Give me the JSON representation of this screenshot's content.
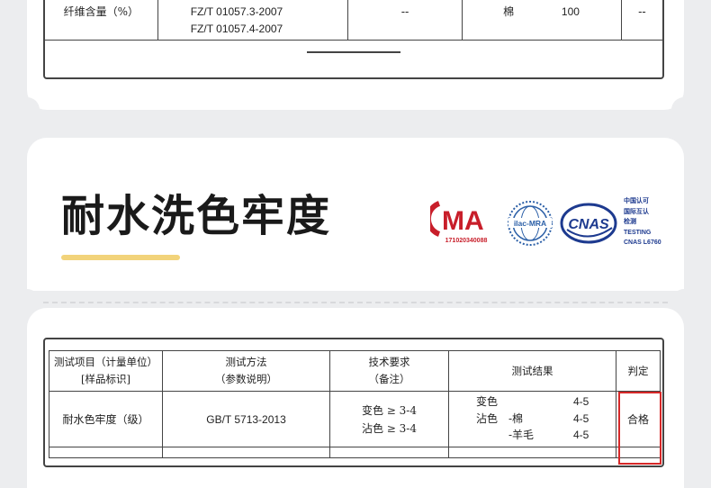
{
  "top_table": {
    "row": {
      "item": "纤维含量（%）",
      "methods": [
        "FZ/T 01057.3-2007",
        "FZ/T 01057.4-2007"
      ],
      "requirement": "--",
      "fiber": "棉",
      "value": "100",
      "verdict": "--"
    }
  },
  "section": {
    "title": "耐水洗色牢度",
    "accent_color": "#f2d37a"
  },
  "logos": {
    "cma": {
      "text": "MA",
      "reg_no": "171020340088"
    },
    "ilac": {
      "text": "ilac-MRA"
    },
    "cnas": {
      "text": "CNAS",
      "lines": [
        "中国认可",
        "国际互认",
        "检测",
        "TESTING",
        "CNAS L6760"
      ]
    }
  },
  "table": {
    "headers": {
      "item_line1": "测试项目（计量单位）",
      "item_line2": "[样品标识]",
      "method_line1": "测试方法",
      "method_line2": "（参数说明）",
      "req_line1": "技术要求",
      "req_line2": "（备注）",
      "result": "测试结果",
      "verdict": "判定"
    },
    "row": {
      "item": "耐水色牢度（级）",
      "method": "GB/T 5713-2013",
      "requirements": [
        "变色 ≥ 3-4",
        "沾色 ≥ 3-4"
      ],
      "results": [
        {
          "label": "变色",
          "sub": "",
          "value": "4-5"
        },
        {
          "label": "沾色",
          "sub": "-棉",
          "value": "4-5"
        },
        {
          "label": "",
          "sub": "-羊毛",
          "value": "4-5"
        }
      ],
      "verdict": "合格"
    }
  }
}
